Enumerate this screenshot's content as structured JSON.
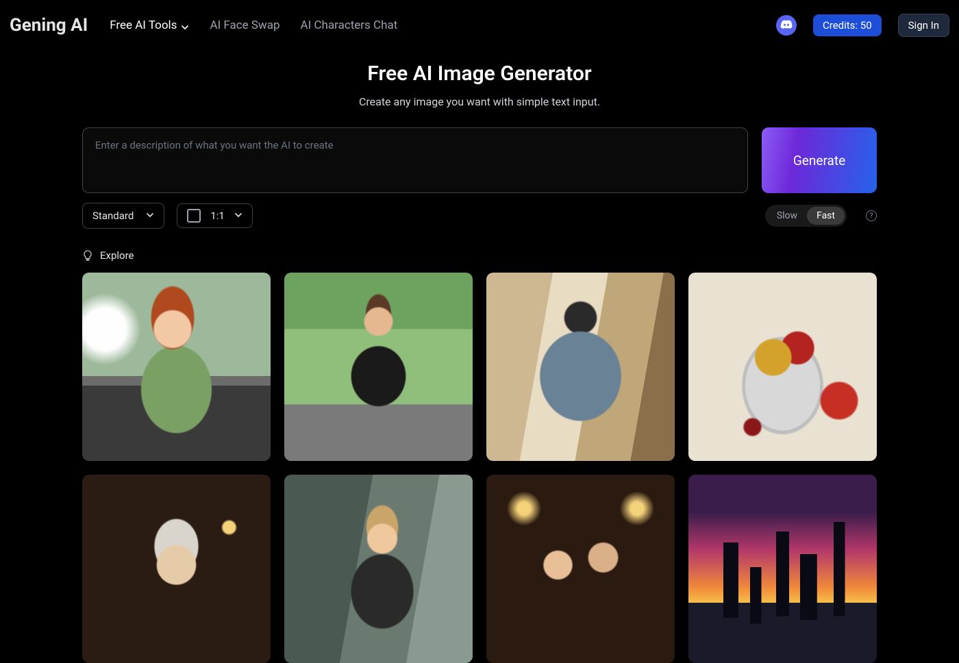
{
  "nav": {
    "brand": "Gening AI",
    "links": {
      "tools": "Free AI Tools",
      "faceswap": "AI Face Swap",
      "chat": "AI Characters Chat"
    },
    "credits": "Credits: 50",
    "signin": "Sign In"
  },
  "hero": {
    "title": "Free AI Image Generator",
    "subtitle": "Create any image you want with simple text input."
  },
  "prompt": {
    "placeholder": "Enter a description of what you want the AI to create",
    "generate": "Generate"
  },
  "controls": {
    "model": "Standard",
    "ratio": "1:1",
    "speed_slow": "Slow",
    "speed_fast": "Fast"
  },
  "explore": {
    "label": "Explore"
  }
}
